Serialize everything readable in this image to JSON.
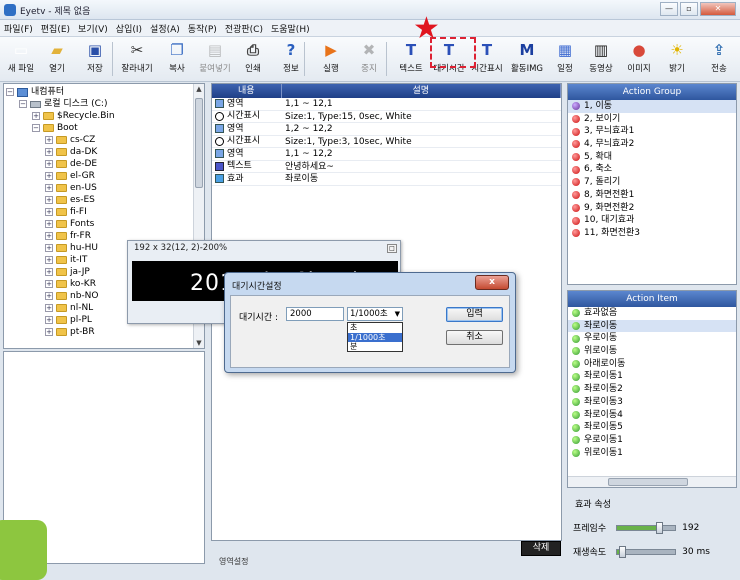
{
  "window": {
    "title": "Eyetv - 제목 없음"
  },
  "menu": [
    "파일(F)",
    "편집(E)",
    "보기(V)",
    "삽입(I)",
    "설정(A)",
    "동작(P)",
    "전광판(C)",
    "도움말(H)"
  ],
  "toolbar": [
    {
      "id": "new",
      "label": "새 파일",
      "icon": "new-file-icon",
      "glyph": "▭",
      "color": "#ffffff",
      "disabled": false
    },
    {
      "id": "open",
      "label": "열기",
      "icon": "open-folder-icon",
      "glyph": "▰",
      "color": "#e2b23a",
      "disabled": false
    },
    {
      "id": "save",
      "label": "저장",
      "icon": "save-disk-icon",
      "glyph": "▣",
      "color": "#2a4fa8",
      "disabled": false
    },
    {
      "id": "cut",
      "label": "잘라내기",
      "icon": "scissors-icon",
      "glyph": "✂",
      "color": "#333333",
      "disabled": false
    },
    {
      "id": "copy",
      "label": "복사",
      "icon": "copy-icon",
      "glyph": "❐",
      "color": "#3d6fc4",
      "disabled": false
    },
    {
      "id": "paste",
      "label": "붙여넣기",
      "icon": "paste-icon",
      "glyph": "▤",
      "color": "#777777",
      "disabled": true
    },
    {
      "id": "print",
      "label": "인쇄",
      "icon": "printer-icon",
      "glyph": "⎙",
      "color": "#444444",
      "disabled": false
    },
    {
      "id": "info",
      "label": "정보",
      "icon": "help-info-icon",
      "glyph": "?",
      "color": "#2a5fbf",
      "disabled": false
    },
    {
      "id": "run",
      "label": "실행",
      "icon": "run-play-icon",
      "glyph": "▶",
      "color": "#e8731a",
      "disabled": false
    },
    {
      "id": "stop",
      "label": "중지",
      "icon": "stop-icon",
      "glyph": "✖",
      "color": "#666666",
      "disabled": true
    },
    {
      "id": "text",
      "label": "텍스트",
      "icon": "text-t-icon",
      "glyph": "T",
      "color": "#2b50b8",
      "disabled": false
    },
    {
      "id": "wait",
      "label": "대기시간",
      "icon": "wait-time-icon",
      "glyph": "T",
      "color": "#2b50b8",
      "disabled": false
    },
    {
      "id": "timedisplay",
      "label": "시간표시",
      "icon": "time-display-icon",
      "glyph": "T",
      "color": "#2b50b8",
      "disabled": false
    },
    {
      "id": "movingimg",
      "label": "활동IMG",
      "icon": "moving-image-icon",
      "glyph": "M",
      "color": "#1b3fa0",
      "disabled": false
    },
    {
      "id": "schedule",
      "label": "일정",
      "icon": "schedule-icon",
      "glyph": "▦",
      "color": "#3d6ad1",
      "disabled": false
    },
    {
      "id": "video",
      "label": "동영상",
      "icon": "film-strip-icon",
      "glyph": "▥",
      "color": "#222222",
      "disabled": false
    },
    {
      "id": "image",
      "label": "이미지",
      "icon": "image-colors-icon",
      "glyph": "●",
      "color": "#d8493a",
      "disabled": false
    },
    {
      "id": "brightness",
      "label": "밝기",
      "icon": "bulb-icon",
      "glyph": "☀",
      "color": "#e1b400",
      "disabled": false
    },
    {
      "id": "send",
      "label": "전송",
      "icon": "transmit-icon",
      "glyph": "⇪",
      "color": "#2f6db0",
      "disabled": false
    }
  ],
  "tree": [
    {
      "label": "내컴퓨터",
      "level": 0,
      "kind": "pc",
      "exp": "−"
    },
    {
      "label": "로컬 디스크 (C:)",
      "level": 1,
      "kind": "drive",
      "exp": "−"
    },
    {
      "label": "$Recycle.Bin",
      "level": 2,
      "kind": "folder",
      "exp": "+"
    },
    {
      "label": "Boot",
      "level": 2,
      "kind": "folder",
      "exp": "−"
    },
    {
      "label": "cs-CZ",
      "level": 3,
      "kind": "folder",
      "exp": "+"
    },
    {
      "label": "da-DK",
      "level": 3,
      "kind": "folder",
      "exp": "+"
    },
    {
      "label": "de-DE",
      "level": 3,
      "kind": "folder",
      "exp": "+"
    },
    {
      "label": "el-GR",
      "level": 3,
      "kind": "folder",
      "exp": "+"
    },
    {
      "label": "en-US",
      "level": 3,
      "kind": "folder",
      "exp": "+"
    },
    {
      "label": "es-ES",
      "level": 3,
      "kind": "folder",
      "exp": "+"
    },
    {
      "label": "fi-FI",
      "level": 3,
      "kind": "folder",
      "exp": "+"
    },
    {
      "label": "Fonts",
      "level": 3,
      "kind": "folder",
      "exp": "+"
    },
    {
      "label": "fr-FR",
      "level": 3,
      "kind": "folder",
      "exp": "+"
    },
    {
      "label": "hu-HU",
      "level": 3,
      "kind": "folder",
      "exp": "+"
    },
    {
      "label": "it-IT",
      "level": 3,
      "kind": "folder",
      "exp": "+"
    },
    {
      "label": "ja-JP",
      "level": 3,
      "kind": "folder",
      "exp": "+"
    },
    {
      "label": "ko-KR",
      "level": 3,
      "kind": "folder",
      "exp": "+"
    },
    {
      "label": "nb-NO",
      "level": 3,
      "kind": "folder",
      "exp": "+"
    },
    {
      "label": "nl-NL",
      "level": 3,
      "kind": "folder",
      "exp": "+"
    },
    {
      "label": "pl-PL",
      "level": 3,
      "kind": "folder",
      "exp": "+"
    },
    {
      "label": "pt-BR",
      "level": 3,
      "kind": "folder",
      "exp": "+"
    }
  ],
  "list": {
    "headers": [
      "내용",
      "설명"
    ],
    "rows": [
      {
        "icon": "area-icon",
        "kind": "",
        "name": "영역",
        "desc": "1,1 ~ 12,1"
      },
      {
        "icon": "clock-icon",
        "kind": "clock",
        "name": "시간표시",
        "desc": "Size:1, Type:15, 0sec, White"
      },
      {
        "icon": "area-icon",
        "kind": "",
        "name": "영역",
        "desc": "1,2 ~ 12,2"
      },
      {
        "icon": "clock-icon",
        "kind": "clock",
        "name": "시간표시",
        "desc": "Size:1, Type:3, 10sec, White"
      },
      {
        "icon": "area-icon",
        "kind": "",
        "name": "영역",
        "desc": "1,1 ~ 12,2"
      },
      {
        "icon": "text-icon",
        "kind": "text",
        "name": "텍스트",
        "desc": "안녕하세요~"
      },
      {
        "icon": "effect-icon",
        "kind": "effect",
        "name": "효과",
        "desc": "좌로이동"
      }
    ],
    "delete_label": "삭제",
    "status_label": "영역설정"
  },
  "action_group": {
    "title": "Action Group",
    "items": [
      {
        "label": "1, 이동",
        "dot": "purple"
      },
      {
        "label": "2, 보이기",
        "dot": "red"
      },
      {
        "label": "3, 무늬효과1",
        "dot": "red"
      },
      {
        "label": "4, 무늬효과2",
        "dot": "red"
      },
      {
        "label": "5, 확대",
        "dot": "red"
      },
      {
        "label": "6, 축소",
        "dot": "red"
      },
      {
        "label": "7, 돌리기",
        "dot": "red"
      },
      {
        "label": "8, 화면전환1",
        "dot": "red"
      },
      {
        "label": "9, 화면전환2",
        "dot": "red"
      },
      {
        "label": "10, 대기효과",
        "dot": "red"
      },
      {
        "label": "11, 화면전환3",
        "dot": "red"
      }
    ]
  },
  "action_item": {
    "title": "Action Item",
    "items": [
      "효과없음",
      "좌로이동",
      "우로이동",
      "위로이동",
      "아래로이동",
      "좌로이동1",
      "좌로이동2",
      "좌로이동3",
      "좌로이동4",
      "좌로이동5",
      "우로이동1",
      "위로이동1"
    ]
  },
  "props": {
    "title": "효과 속성",
    "frame_label": "프레임수",
    "frame_value": "192",
    "frame_fraction": 0.72,
    "speed_label": "재생속도",
    "speed_value": "30 ms",
    "speed_fraction": 0.08
  },
  "preview": {
    "title": "192 x 32(12, 2)-200%",
    "led_text": "2012년  9월  9일"
  },
  "dialog": {
    "title": "대기시간설정",
    "close_label": "x",
    "label": "대기시간 :",
    "value": "2000",
    "unit_selected": "1/1000초",
    "unit_options": [
      "초",
      "1/1000초",
      "분"
    ],
    "ok_label": "입력",
    "cancel_label": "취소"
  },
  "colors": {
    "accent_header": "#2f569e",
    "highlight": "#e0141e"
  }
}
